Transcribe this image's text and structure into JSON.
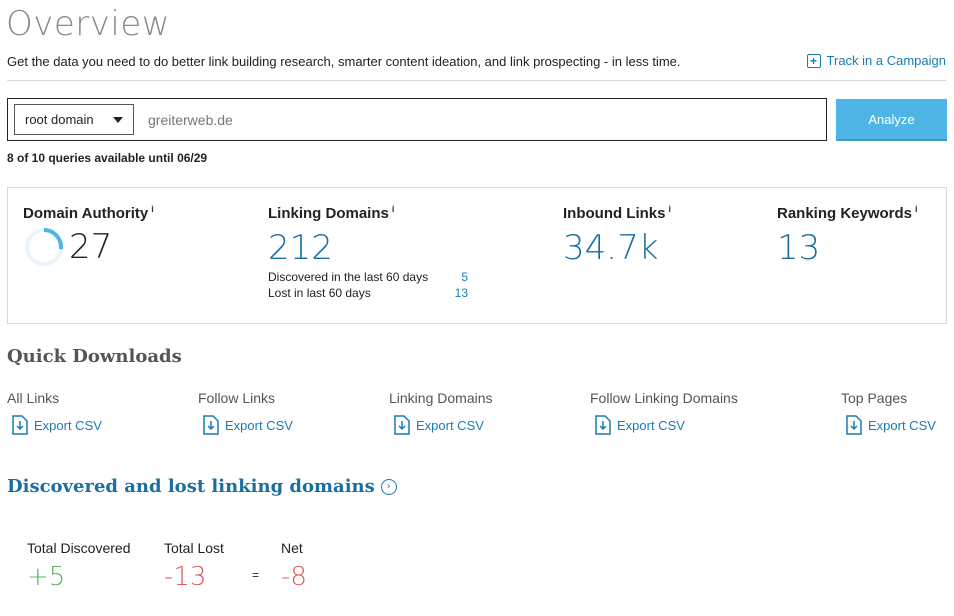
{
  "header": {
    "title": "Overview",
    "subtitle": "Get the data you need to do better link building research, smarter content ideation, and link prospecting - in less time.",
    "track_label": "Track in a Campaign"
  },
  "search": {
    "scope": "root domain",
    "value": "greiterweb.de",
    "analyze_label": "Analyze",
    "quota": "8 of 10 queries available until 06/29"
  },
  "metrics": {
    "domain_authority": {
      "label": "Domain Authority",
      "value": "27",
      "ring_fraction": 0.27
    },
    "linking_domains": {
      "label": "Linking Domains",
      "value": "212",
      "discovered_label": "Discovered in the last 60 days",
      "discovered_value": "5",
      "lost_label": "Lost in last 60 days",
      "lost_value": "13"
    },
    "inbound_links": {
      "label": "Inbound Links",
      "value": "34.7k"
    },
    "ranking_keywords": {
      "label": "Ranking Keywords",
      "value": "13"
    },
    "info_marker": "i"
  },
  "quick_downloads": {
    "heading": "Quick Downloads",
    "export_label": "Export CSV",
    "items": [
      {
        "label": "All Links"
      },
      {
        "label": "Follow Links"
      },
      {
        "label": "Linking Domains"
      },
      {
        "label": "Follow Linking Domains"
      },
      {
        "label": "Top Pages"
      }
    ]
  },
  "discovered_lost": {
    "heading": "Discovered and lost linking domains",
    "total_discovered_label": "Total Discovered",
    "total_discovered_value": "+5",
    "total_lost_label": "Total Lost",
    "total_lost_value": "-13",
    "equals": "=",
    "net_label": "Net",
    "net_value": "-8"
  },
  "colors": {
    "accent": "#1a7bb5",
    "analyze": "#4eb6e6",
    "positive": "#5cb85c",
    "negative": "#e45a5a"
  }
}
